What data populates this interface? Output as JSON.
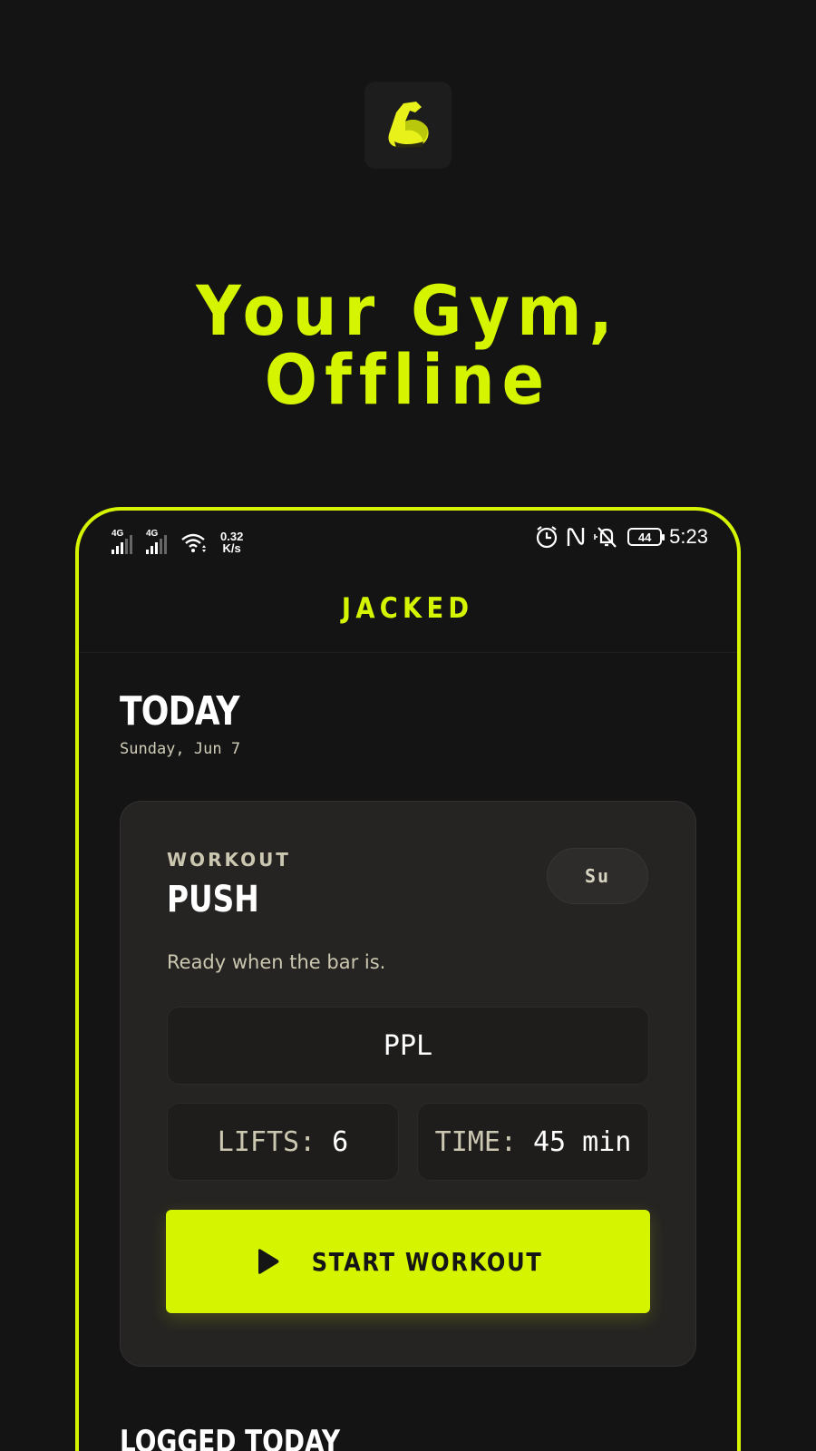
{
  "promo": {
    "tagline": "Your Gym, Offline",
    "app_icon": "flexed-bicep-icon"
  },
  "status_bar": {
    "sim1": "4G",
    "sim2": "4G",
    "net_speed_value": "0.32",
    "net_speed_unit": "K/s",
    "battery": "44",
    "time": "5:23",
    "icons": [
      "signal-icon",
      "wifi-icon",
      "alarm-icon",
      "nfc-icon",
      "mute-icon",
      "battery-icon"
    ]
  },
  "app": {
    "title": "JACKED"
  },
  "today": {
    "heading": "TODAY",
    "date": "Sunday, Jun 7"
  },
  "workout_card": {
    "kicker": "WORKOUT",
    "title": "PUSH",
    "day_badge": "Su",
    "subtitle": "Ready when the bar is.",
    "program": "PPL",
    "lifts_label": "LIFTS:",
    "lifts_value": "6",
    "time_label": "TIME:",
    "time_value": "45 min",
    "start_label": "START WORKOUT"
  },
  "logged": {
    "heading": "LOGGED TODAY"
  },
  "colors": {
    "accent": "#d4f400",
    "background": "#141414",
    "card": "#262422",
    "muted_text": "#cbc7b0"
  }
}
